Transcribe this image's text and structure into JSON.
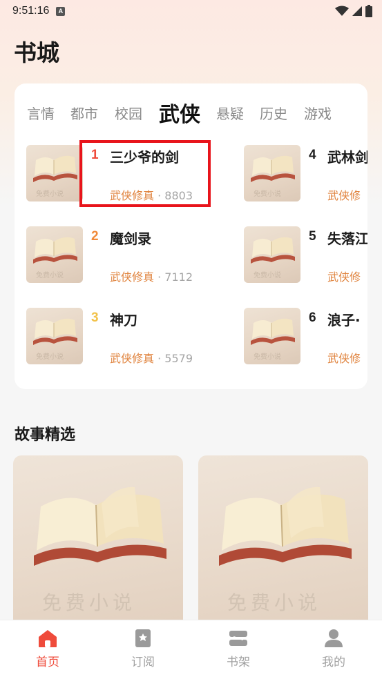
{
  "status_bar": {
    "time": "9:51:16",
    "notification_badge": "A"
  },
  "page": {
    "title": "书城"
  },
  "tabs": [
    {
      "label": "言情",
      "active": false
    },
    {
      "label": "都市",
      "active": false
    },
    {
      "label": "校园",
      "active": false
    },
    {
      "label": "武侠",
      "active": true
    },
    {
      "label": "悬疑",
      "active": false
    },
    {
      "label": "历史",
      "active": false
    },
    {
      "label": "游戏",
      "active": false
    }
  ],
  "ranking": [
    {
      "rank": "1",
      "title": "三少爷的剑",
      "category": "武侠修真",
      "separator": "·",
      "count": "8803",
      "rank_color": "#ef4b3b"
    },
    {
      "rank": "2",
      "title": "魔剑录",
      "category": "武侠修真",
      "separator": "·",
      "count": "7112",
      "rank_color": "#f08a3a"
    },
    {
      "rank": "3",
      "title": "神刀",
      "category": "武侠修真",
      "separator": "·",
      "count": "5579",
      "rank_color": "#f2c24a"
    },
    {
      "rank": "4",
      "title": "武林剑",
      "category": "武侠修",
      "separator": "",
      "count": "",
      "rank_color": "#222222"
    },
    {
      "rank": "5",
      "title": "失落江",
      "category": "武侠修",
      "separator": "",
      "count": "",
      "rank_color": "#222222"
    },
    {
      "rank": "6",
      "title": "浪子·",
      "category": "武侠修",
      "separator": "",
      "count": "",
      "rank_color": "#222222"
    }
  ],
  "cover_watermark": "免费小说",
  "stories": {
    "section_title": "故事精选",
    "cards": [
      {
        "watermark": "免费小说"
      },
      {
        "watermark": "免费小说"
      }
    ]
  },
  "bottom_nav": [
    {
      "label": "首页",
      "icon": "home-icon",
      "active": true
    },
    {
      "label": "订阅",
      "icon": "bookmark-icon",
      "active": false
    },
    {
      "label": "书架",
      "icon": "bookshelf-icon",
      "active": false
    },
    {
      "label": "我的",
      "icon": "profile-icon",
      "active": false
    }
  ],
  "colors": {
    "accent": "#ef4b3b",
    "category": "#e0843f",
    "highlight": "#e8141b"
  }
}
